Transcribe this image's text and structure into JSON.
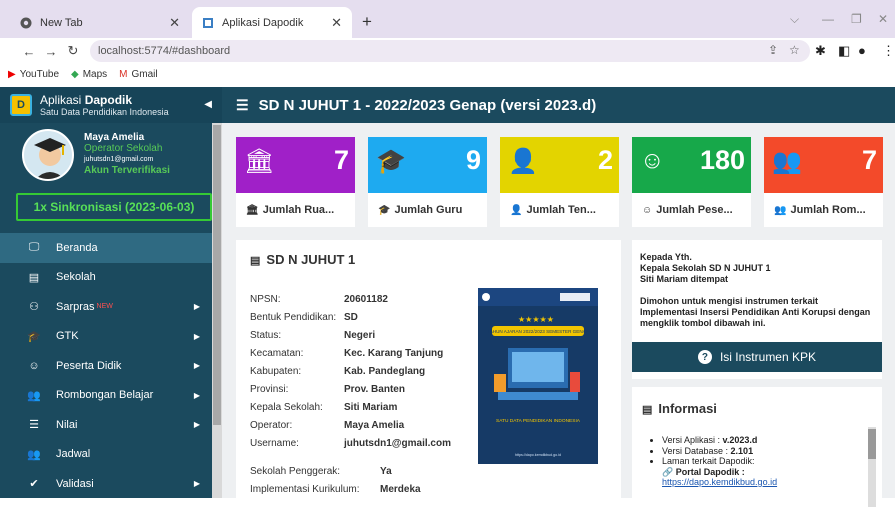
{
  "browser": {
    "tabs": [
      {
        "label": "New Tab",
        "icon": "chrome-icon",
        "active": false
      },
      {
        "label": "Aplikasi Dapodik",
        "icon": "dapodik-favicon",
        "active": true
      }
    ],
    "url": "localhost:5774/#dashboard",
    "bookmarks": [
      {
        "label": "YouTube",
        "icon": "youtube-icon"
      },
      {
        "label": "Maps",
        "icon": "maps-icon"
      },
      {
        "label": "Gmail",
        "icon": "gmail-icon"
      }
    ]
  },
  "brand": {
    "app_prefix": "Aplikasi ",
    "app_name": "Dapodik",
    "subtitle": "Satu Data Pendidikan Indonesia"
  },
  "profile": {
    "name": "Maya Amelia",
    "role": "Operator Sekolah",
    "email": "juhutsdn1@gmail.com",
    "status": "Akun Terverifikasi"
  },
  "sync_label": "1x Sinkronisasi (2023-06-03)",
  "menu": [
    {
      "label": "Beranda",
      "icon": "monitor-icon",
      "active": true,
      "submenu": false
    },
    {
      "label": "Sekolah",
      "icon": "building-icon",
      "submenu": false
    },
    {
      "label": "Sarpras",
      "icon": "binoculars-icon",
      "badge": "NEW",
      "submenu": true
    },
    {
      "label": "GTK",
      "icon": "graduation-cap-icon",
      "submenu": true
    },
    {
      "label": "Peserta Didik",
      "icon": "smile-icon",
      "submenu": true
    },
    {
      "label": "Rombongan Belajar",
      "icon": "group-icon",
      "submenu": true
    },
    {
      "label": "Nilai",
      "icon": "list-icon",
      "submenu": true
    },
    {
      "label": "Jadwal",
      "icon": "group-icon",
      "submenu": false
    },
    {
      "label": "Validasi",
      "icon": "check-icon",
      "submenu": true
    }
  ],
  "header_title": "SD N JUHUT 1 - 2022/2023 Genap (versi 2023.d)",
  "stats": [
    {
      "value": "7",
      "label": "Jumlah Rua...",
      "color": "#a020c8",
      "icon": "institution-icon"
    },
    {
      "value": "9",
      "label": "Jumlah Guru",
      "color": "#1eaaf0",
      "icon": "graduation-cap-icon"
    },
    {
      "value": "2",
      "label": "Jumlah Ten...",
      "color": "#e3d400",
      "icon": "user-icon"
    },
    {
      "value": "180",
      "label": "Jumlah Pese...",
      "color": "#17a84a",
      "icon": "smile-icon"
    },
    {
      "value": "7",
      "label": "Jumlah Rom...",
      "color": "#f34a2a",
      "icon": "group-icon"
    }
  ],
  "school": {
    "title": "SD N JUHUT 1",
    "fields": [
      {
        "k": "NPSN:",
        "v": "20601182"
      },
      {
        "k": "Bentuk Pendidikan:",
        "v": "SD"
      },
      {
        "k": "Status:",
        "v": "Negeri"
      },
      {
        "k": "Kecamatan:",
        "v": "Kec. Karang Tanjung"
      },
      {
        "k": "Kabupaten:",
        "v": "Kab. Pandeglang"
      },
      {
        "k": "Provinsi:",
        "v": "Prov. Banten"
      },
      {
        "k": "Kepala Sekolah:",
        "v": "Siti Mariam"
      },
      {
        "k": "Operator:",
        "v": "Maya Amelia"
      },
      {
        "k": "Username:",
        "v": "juhutsdn1@gmail.com"
      }
    ],
    "fields2": [
      {
        "k": "Sekolah Penggerak:",
        "v": "Ya"
      },
      {
        "k": "Implementasi Kurikulum:",
        "v": "Merdeka"
      }
    ],
    "poster": {
      "banner": "TAHUN AJARAN 2022/2023 SEMESTER GENAP",
      "caption": "SATU DATA PENDIDIKAN INDONESIA",
      "url": "https://dapo.kemdikbud.go.id"
    }
  },
  "kpk": {
    "line1": "Kepada Yth.",
    "line2": "Kepala Sekolah SD N JUHUT 1",
    "line3": "Siti Mariam ditempat",
    "body": "Dimohon untuk mengisi instrumen terkait Implementasi Insersi Pendidikan Anti Korupsi dengan mengklik tombol dibawah ini.",
    "button": "Isi Instrumen KPK"
  },
  "info": {
    "title": "Informasi",
    "items": [
      {
        "label": "Versi Aplikasi : ",
        "value": "v.2023.d"
      },
      {
        "label": "Versi Database : ",
        "value": "2.101"
      },
      {
        "label": "Laman terkait Dapodik:",
        "value": ""
      }
    ],
    "portal_label": "Portal Dapodik :",
    "portal_url": "https://dapo.kemdikbud.go.id"
  }
}
